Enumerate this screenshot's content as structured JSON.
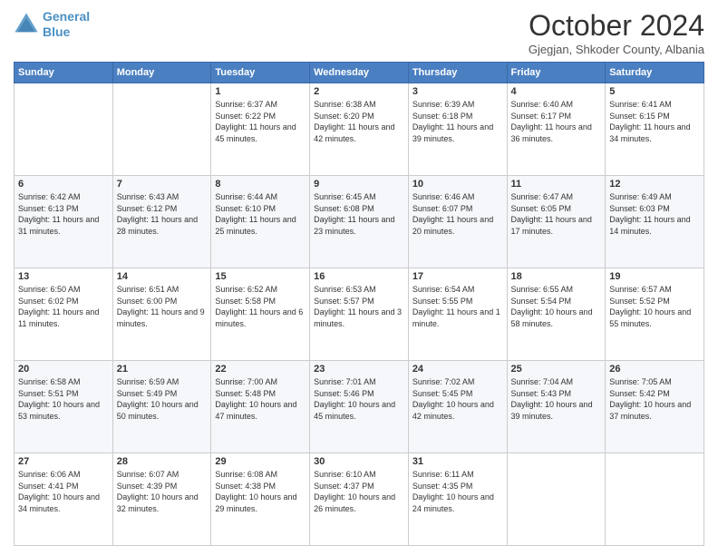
{
  "header": {
    "logo_line1": "General",
    "logo_line2": "Blue",
    "month": "October 2024",
    "location": "Gjegjan, Shkoder County, Albania"
  },
  "weekdays": [
    "Sunday",
    "Monday",
    "Tuesday",
    "Wednesday",
    "Thursday",
    "Friday",
    "Saturday"
  ],
  "weeks": [
    [
      {
        "day": "",
        "sunrise": "",
        "sunset": "",
        "daylight": ""
      },
      {
        "day": "",
        "sunrise": "",
        "sunset": "",
        "daylight": ""
      },
      {
        "day": "1",
        "sunrise": "Sunrise: 6:37 AM",
        "sunset": "Sunset: 6:22 PM",
        "daylight": "Daylight: 11 hours and 45 minutes."
      },
      {
        "day": "2",
        "sunrise": "Sunrise: 6:38 AM",
        "sunset": "Sunset: 6:20 PM",
        "daylight": "Daylight: 11 hours and 42 minutes."
      },
      {
        "day": "3",
        "sunrise": "Sunrise: 6:39 AM",
        "sunset": "Sunset: 6:18 PM",
        "daylight": "Daylight: 11 hours and 39 minutes."
      },
      {
        "day": "4",
        "sunrise": "Sunrise: 6:40 AM",
        "sunset": "Sunset: 6:17 PM",
        "daylight": "Daylight: 11 hours and 36 minutes."
      },
      {
        "day": "5",
        "sunrise": "Sunrise: 6:41 AM",
        "sunset": "Sunset: 6:15 PM",
        "daylight": "Daylight: 11 hours and 34 minutes."
      }
    ],
    [
      {
        "day": "6",
        "sunrise": "Sunrise: 6:42 AM",
        "sunset": "Sunset: 6:13 PM",
        "daylight": "Daylight: 11 hours and 31 minutes."
      },
      {
        "day": "7",
        "sunrise": "Sunrise: 6:43 AM",
        "sunset": "Sunset: 6:12 PM",
        "daylight": "Daylight: 11 hours and 28 minutes."
      },
      {
        "day": "8",
        "sunrise": "Sunrise: 6:44 AM",
        "sunset": "Sunset: 6:10 PM",
        "daylight": "Daylight: 11 hours and 25 minutes."
      },
      {
        "day": "9",
        "sunrise": "Sunrise: 6:45 AM",
        "sunset": "Sunset: 6:08 PM",
        "daylight": "Daylight: 11 hours and 23 minutes."
      },
      {
        "day": "10",
        "sunrise": "Sunrise: 6:46 AM",
        "sunset": "Sunset: 6:07 PM",
        "daylight": "Daylight: 11 hours and 20 minutes."
      },
      {
        "day": "11",
        "sunrise": "Sunrise: 6:47 AM",
        "sunset": "Sunset: 6:05 PM",
        "daylight": "Daylight: 11 hours and 17 minutes."
      },
      {
        "day": "12",
        "sunrise": "Sunrise: 6:49 AM",
        "sunset": "Sunset: 6:03 PM",
        "daylight": "Daylight: 11 hours and 14 minutes."
      }
    ],
    [
      {
        "day": "13",
        "sunrise": "Sunrise: 6:50 AM",
        "sunset": "Sunset: 6:02 PM",
        "daylight": "Daylight: 11 hours and 11 minutes."
      },
      {
        "day": "14",
        "sunrise": "Sunrise: 6:51 AM",
        "sunset": "Sunset: 6:00 PM",
        "daylight": "Daylight: 11 hours and 9 minutes."
      },
      {
        "day": "15",
        "sunrise": "Sunrise: 6:52 AM",
        "sunset": "Sunset: 5:58 PM",
        "daylight": "Daylight: 11 hours and 6 minutes."
      },
      {
        "day": "16",
        "sunrise": "Sunrise: 6:53 AM",
        "sunset": "Sunset: 5:57 PM",
        "daylight": "Daylight: 11 hours and 3 minutes."
      },
      {
        "day": "17",
        "sunrise": "Sunrise: 6:54 AM",
        "sunset": "Sunset: 5:55 PM",
        "daylight": "Daylight: 11 hours and 1 minute."
      },
      {
        "day": "18",
        "sunrise": "Sunrise: 6:55 AM",
        "sunset": "Sunset: 5:54 PM",
        "daylight": "Daylight: 10 hours and 58 minutes."
      },
      {
        "day": "19",
        "sunrise": "Sunrise: 6:57 AM",
        "sunset": "Sunset: 5:52 PM",
        "daylight": "Daylight: 10 hours and 55 minutes."
      }
    ],
    [
      {
        "day": "20",
        "sunrise": "Sunrise: 6:58 AM",
        "sunset": "Sunset: 5:51 PM",
        "daylight": "Daylight: 10 hours and 53 minutes."
      },
      {
        "day": "21",
        "sunrise": "Sunrise: 6:59 AM",
        "sunset": "Sunset: 5:49 PM",
        "daylight": "Daylight: 10 hours and 50 minutes."
      },
      {
        "day": "22",
        "sunrise": "Sunrise: 7:00 AM",
        "sunset": "Sunset: 5:48 PM",
        "daylight": "Daylight: 10 hours and 47 minutes."
      },
      {
        "day": "23",
        "sunrise": "Sunrise: 7:01 AM",
        "sunset": "Sunset: 5:46 PM",
        "daylight": "Daylight: 10 hours and 45 minutes."
      },
      {
        "day": "24",
        "sunrise": "Sunrise: 7:02 AM",
        "sunset": "Sunset: 5:45 PM",
        "daylight": "Daylight: 10 hours and 42 minutes."
      },
      {
        "day": "25",
        "sunrise": "Sunrise: 7:04 AM",
        "sunset": "Sunset: 5:43 PM",
        "daylight": "Daylight: 10 hours and 39 minutes."
      },
      {
        "day": "26",
        "sunrise": "Sunrise: 7:05 AM",
        "sunset": "Sunset: 5:42 PM",
        "daylight": "Daylight: 10 hours and 37 minutes."
      }
    ],
    [
      {
        "day": "27",
        "sunrise": "Sunrise: 6:06 AM",
        "sunset": "Sunset: 4:41 PM",
        "daylight": "Daylight: 10 hours and 34 minutes."
      },
      {
        "day": "28",
        "sunrise": "Sunrise: 6:07 AM",
        "sunset": "Sunset: 4:39 PM",
        "daylight": "Daylight: 10 hours and 32 minutes."
      },
      {
        "day": "29",
        "sunrise": "Sunrise: 6:08 AM",
        "sunset": "Sunset: 4:38 PM",
        "daylight": "Daylight: 10 hours and 29 minutes."
      },
      {
        "day": "30",
        "sunrise": "Sunrise: 6:10 AM",
        "sunset": "Sunset: 4:37 PM",
        "daylight": "Daylight: 10 hours and 26 minutes."
      },
      {
        "day": "31",
        "sunrise": "Sunrise: 6:11 AM",
        "sunset": "Sunset: 4:35 PM",
        "daylight": "Daylight: 10 hours and 24 minutes."
      },
      {
        "day": "",
        "sunrise": "",
        "sunset": "",
        "daylight": ""
      },
      {
        "day": "",
        "sunrise": "",
        "sunset": "",
        "daylight": ""
      }
    ]
  ]
}
